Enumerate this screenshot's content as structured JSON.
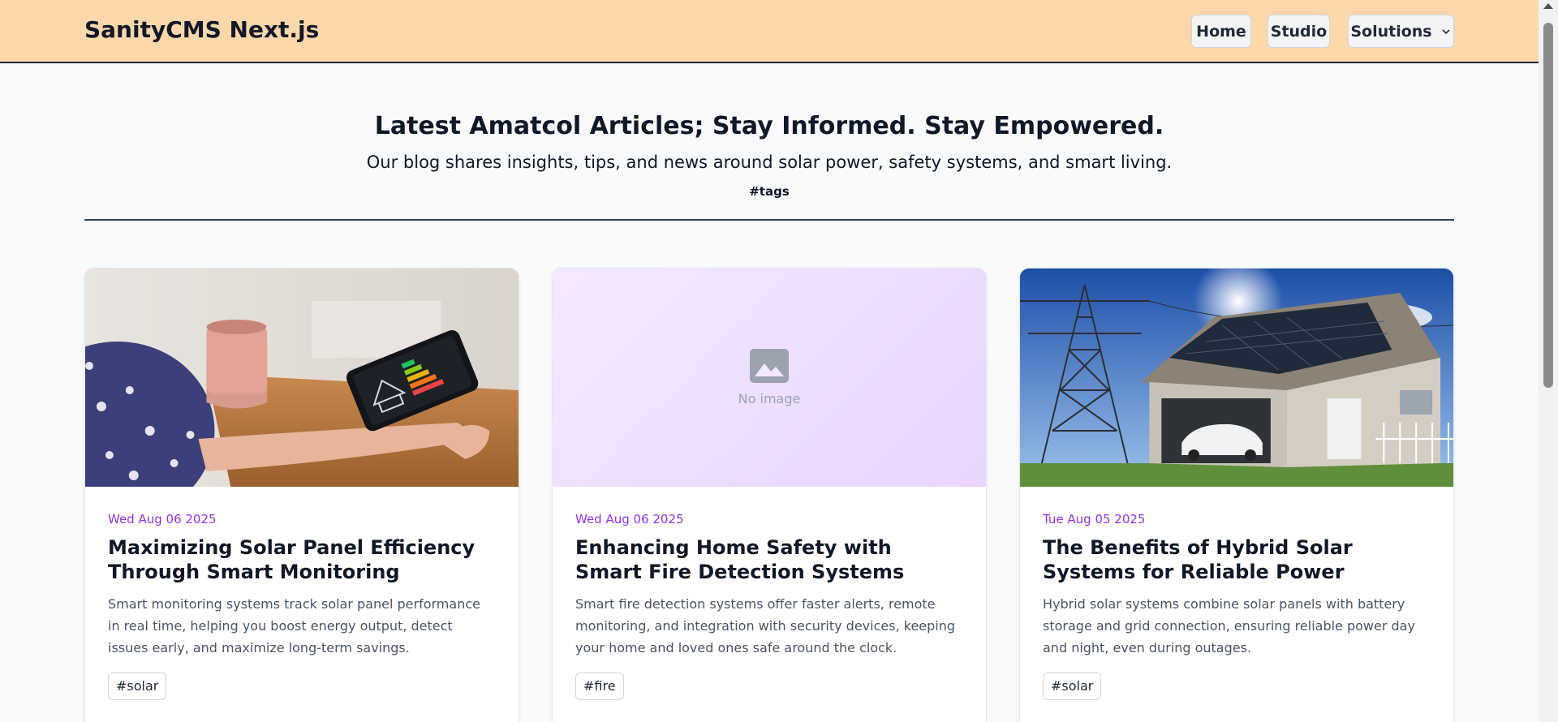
{
  "navbar": {
    "brand": "SanityCMS Next.js",
    "links": [
      {
        "label": "Home"
      },
      {
        "label": "Studio"
      },
      {
        "label": "Solutions"
      }
    ],
    "background": "#fed7aa"
  },
  "hero": {
    "title": "Latest Amatcol Articles; Stay Informed. Stay Empowered.",
    "subtitle": "Our blog shares insights, tips, and news around solar power, safety systems, and smart living.",
    "tags_label": "#tags"
  },
  "posts": [
    {
      "date": "Wed Aug 06 2025",
      "title": "Maximizing Solar Panel Efficiency Through Smart Monitoring",
      "excerpt": "Smart monitoring systems track solar panel performance in real time, helping you boost energy output, detect issues early, and maximize long-term savings.",
      "tag": "#solar",
      "image": "photo-hand-holding-phone-energy-app"
    },
    {
      "date": "Wed Aug 06 2025",
      "title": "Enhancing Home Safety with Smart Fire Detection Systems",
      "excerpt": "Smart fire detection systems offer faster alerts, remote monitoring, and integration with security devices, keeping your home and loved ones safe around the clock.",
      "tag": "#fire",
      "image_placeholder": "No image"
    },
    {
      "date": "Tue Aug 05 2025",
      "title": "The Benefits of Hybrid Solar Systems for Reliable Power",
      "excerpt": "Hybrid solar systems combine solar panels with battery storage and grid connection, ensuring reliable power day and night, even during outages.",
      "tag": "#solar",
      "image": "photo-house-solar-roof-pylon"
    }
  ],
  "colors": {
    "date": "#9333ea",
    "accent_bg": "#fed7aa"
  }
}
